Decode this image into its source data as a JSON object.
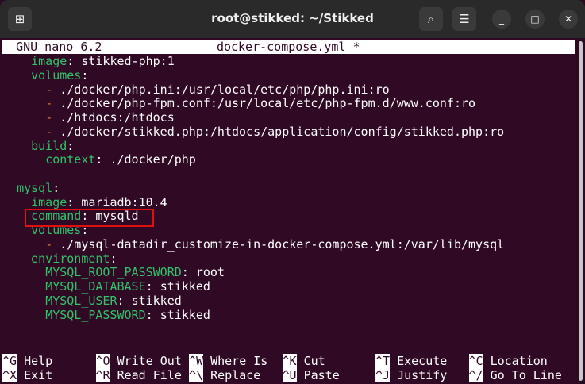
{
  "window": {
    "title": "root@stikked: ~/Stikked"
  },
  "nano": {
    "header_left": "GNU nano 6.2",
    "header_file": "docker-compose.yml *"
  },
  "lines": [
    {
      "indent": "    ",
      "key": "image",
      "sep": ": ",
      "val": "stikked-php:1"
    },
    {
      "indent": "    ",
      "key": "volumes",
      "sep": ":",
      "val": ""
    },
    {
      "indent": "      ",
      "dash": "-",
      "val": " ./docker/php.ini:/usr/local/etc/php/php.ini:ro"
    },
    {
      "indent": "      ",
      "dash": "-",
      "val": " ./docker/php-fpm.conf:/usr/local/etc/php-fpm.d/www.conf:ro"
    },
    {
      "indent": "      ",
      "dash": "-",
      "val": " ./htdocs:/htdocs"
    },
    {
      "indent": "      ",
      "dash": "-",
      "val": " ./docker/stikked.php:/htdocs/application/config/stikked.php:ro"
    },
    {
      "indent": "    ",
      "key": "build",
      "sep": ":",
      "val": ""
    },
    {
      "indent": "      ",
      "key": "context",
      "sep": ": ",
      "val": "./docker/php"
    },
    {
      "indent": "",
      "val": ""
    },
    {
      "indent": "  ",
      "key": "mysql",
      "sep": ":",
      "val": ""
    },
    {
      "indent": "    ",
      "key": "image",
      "sep": ": ",
      "val": "mariadb:10.4"
    },
    {
      "indent": "    ",
      "key": "command",
      "sep": ": ",
      "val": "mysqld"
    },
    {
      "indent": "    ",
      "key": "volumes",
      "sep": ":",
      "val": ""
    },
    {
      "indent": "      ",
      "dash": "-",
      "val": " ./mysql-datadir_customize-in-docker-compose.yml:/var/lib/mysql"
    },
    {
      "indent": "    ",
      "key": "environment",
      "sep": ":",
      "val": ""
    },
    {
      "indent": "      ",
      "key": "MYSQL_ROOT_PASSWORD",
      "sep": ": ",
      "val": "root"
    },
    {
      "indent": "      ",
      "key": "MYSQL_DATABASE",
      "sep": ": ",
      "val": "stikked"
    },
    {
      "indent": "      ",
      "key": "MYSQL_USER",
      "sep": ": ",
      "val": "stikked"
    },
    {
      "indent": "      ",
      "key": "MYSQL_PASSWORD",
      "sep": ": ",
      "val": "stikked"
    }
  ],
  "shortcuts": [
    [
      {
        "key": "^G",
        "label": "Help"
      },
      {
        "key": "^O",
        "label": "Write Out"
      },
      {
        "key": "^W",
        "label": "Where Is"
      },
      {
        "key": "^K",
        "label": "Cut"
      },
      {
        "key": "^T",
        "label": "Execute"
      },
      {
        "key": "^C",
        "label": "Location"
      }
    ],
    [
      {
        "key": "^X",
        "label": "Exit"
      },
      {
        "key": "^R",
        "label": "Read File"
      },
      {
        "key": "^\\",
        "label": "Replace"
      },
      {
        "key": "^U",
        "label": "Paste"
      },
      {
        "key": "^J",
        "label": "Justify"
      },
      {
        "key": "^/",
        "label": "Go To Line"
      }
    ]
  ],
  "colors": {
    "background": "#300a24",
    "key": "#33c26b",
    "highlight": "#e01010"
  }
}
